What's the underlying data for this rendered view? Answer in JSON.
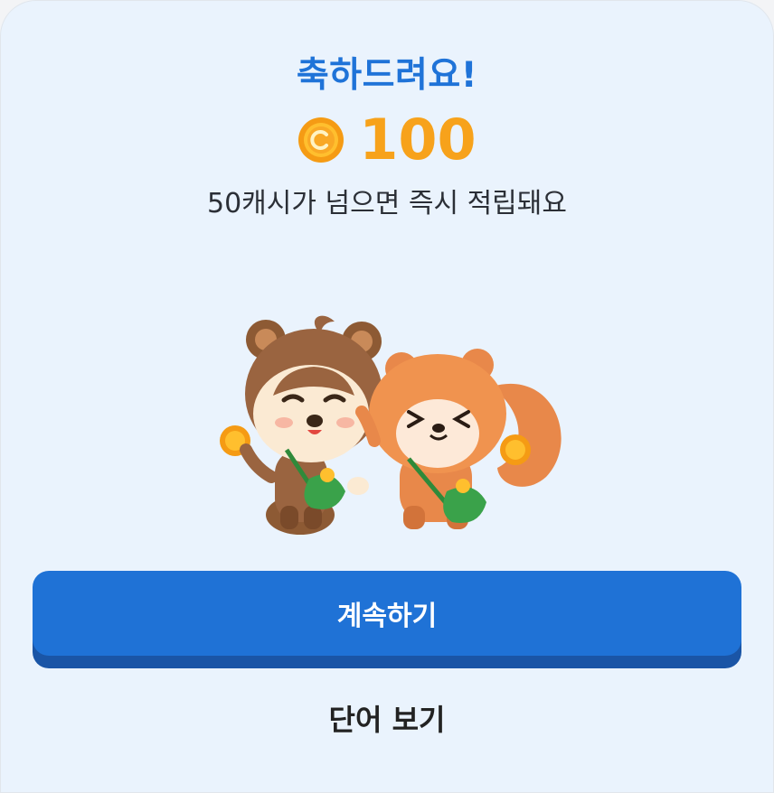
{
  "dialog": {
    "title": "축하드려요!",
    "reward_amount": "100",
    "reward_icon": "coin-icon",
    "message": "50캐시가 넘으면 즉시 적립돼요",
    "illustration": "mascot-characters",
    "primary_button_label": "계속하기",
    "secondary_link_label": "단어 보기"
  },
  "colors": {
    "accent": "#1f72d6",
    "title": "#1f73d8",
    "reward": "#f7a21b",
    "background": "#eaf3fd"
  }
}
